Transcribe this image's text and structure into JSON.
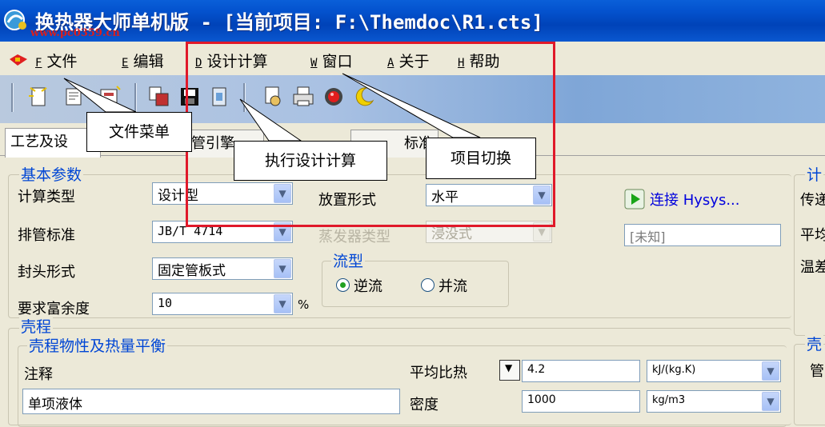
{
  "window": {
    "title": "换热器大师单机版 - [当前项目: F:\\Themdoc\\R1.cts]",
    "watermark": "www.pc0359.cn"
  },
  "menu": [
    {
      "hotkey": "F",
      "label": "文件"
    },
    {
      "hotkey": "E",
      "label": "编辑"
    },
    {
      "hotkey": "D",
      "label": "设计计算"
    },
    {
      "hotkey": "W",
      "label": "窗口"
    },
    {
      "hotkey": "A",
      "label": "关于"
    },
    {
      "hotkey": "H",
      "label": "帮助"
    }
  ],
  "tabs": [
    "工艺及设",
    "管引擎",
    "标准"
  ],
  "callouts": {
    "file_menu": "文件菜单",
    "design_calc": "执行设计计算",
    "project_switch": "项目切换"
  },
  "basic_params": {
    "title": "基本参数",
    "calc_type_label": "计算类型",
    "calc_type_value": "设计型",
    "tube_standard_label": "排管标准",
    "tube_standard_value": "JB/T 4714",
    "head_type_label": "封头形式",
    "head_type_value": "固定管板式",
    "margin_label": "要求富余度",
    "margin_value": "10",
    "margin_unit": "%",
    "placement_label": "放置形式",
    "placement_value": "水平",
    "evaporator_label": "蒸发器类型",
    "evaporator_value": "浸没式",
    "flow_title": "流型",
    "flow_counter": "逆流",
    "flow_parallel": "并流",
    "connect_label": "连接 Hysys...",
    "status_value": "[未知]"
  },
  "right_panel": {
    "title": "计",
    "line1": "传递",
    "line2": "平均",
    "line3": "温差"
  },
  "shell": {
    "title": "壳程",
    "sub_title": "壳程物性及热量平衡",
    "note_label": "注释",
    "note_value": "单项液体",
    "cp_label": "平均比热",
    "cp_value": "4.2",
    "cp_unit": "kJ/(kg.K)",
    "density_label": "密度",
    "density_value": "1000",
    "density_unit": "kg/m3",
    "right_title": "壳",
    "right_sub": "管"
  }
}
